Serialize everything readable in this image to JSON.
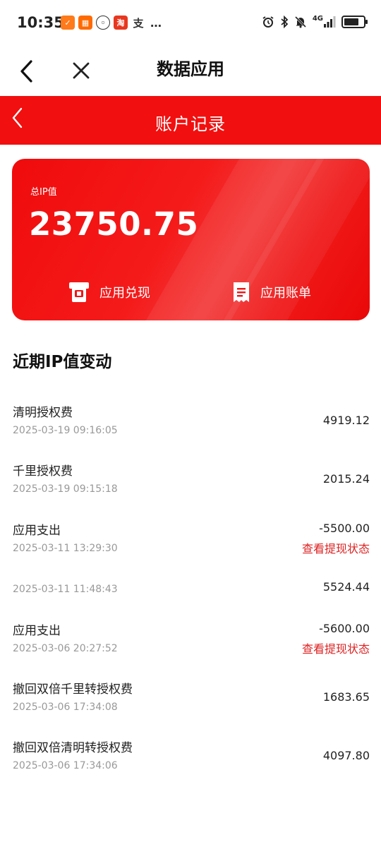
{
  "status_bar": {
    "time": "10:35",
    "network": "4G",
    "apps": [
      {
        "icon": "shield-app-icon",
        "color": "#ff7a1a",
        "glyph": "✓"
      },
      {
        "icon": "squares-app-icon",
        "color": "#ff6a00",
        "glyph": "▦"
      },
      {
        "icon": "chat-bubble-icon",
        "color": "#ffffff",
        "glyph": "💬"
      },
      {
        "icon": "taobao-app-icon",
        "color": "#e8371f",
        "glyph": "淘"
      },
      {
        "icon": "alipay-app-icon",
        "color": "#ffffff",
        "glyph": "支"
      },
      {
        "icon": "more-dots-icon",
        "color": "#ffffff",
        "glyph": "…"
      }
    ]
  },
  "nav": {
    "title": "数据应用"
  },
  "header": {
    "title": "账户记录",
    "color": "#f20f0f"
  },
  "card": {
    "label": "总IP值",
    "value": "23750.75",
    "actions": [
      {
        "label": "应用兑现",
        "icon": "atm-icon"
      },
      {
        "label": "应用账单",
        "icon": "receipt-icon"
      }
    ]
  },
  "section": {
    "title": "近期IP值变动"
  },
  "records": [
    {
      "title": "清明授权费",
      "time": "2025-03-19 09:16:05",
      "amount": "4919.12",
      "link": ""
    },
    {
      "title": "千里授权费",
      "time": "2025-03-19 09:15:18",
      "amount": "2015.24",
      "link": ""
    },
    {
      "title": "应用支出",
      "time": "2025-03-11 13:29:30",
      "amount": "-5500.00",
      "link": "查看提现状态"
    },
    {
      "title": "",
      "time": "2025-03-11 11:48:43",
      "amount": "5524.44",
      "link": ""
    },
    {
      "title": "应用支出",
      "time": "2025-03-06 20:27:52",
      "amount": "-5600.00",
      "link": "查看提现状态"
    },
    {
      "title": "撤回双倍千里转授权费",
      "time": "2025-03-06 17:34:08",
      "amount": "1683.65",
      "link": ""
    },
    {
      "title": "撤回双倍清明转授权费",
      "time": "2025-03-06 17:34:06",
      "amount": "4097.80",
      "link": ""
    }
  ]
}
